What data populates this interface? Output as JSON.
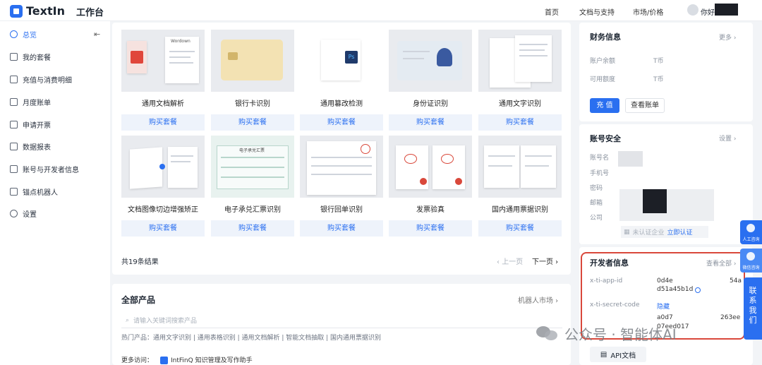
{
  "topbar": {
    "logo_text": "TextIn",
    "workbench": "工作台",
    "nav": [
      "首页",
      "文档与支持",
      "市场/价格"
    ],
    "greeting": "你好，"
  },
  "sidebar": {
    "items": [
      {
        "label": "总览",
        "icon": "dashboard-icon",
        "active": true
      },
      {
        "label": "我的套餐",
        "icon": "grid-icon"
      },
      {
        "label": "充值与消费明细",
        "icon": "wallet-icon"
      },
      {
        "label": "月度账单",
        "icon": "bill-icon"
      },
      {
        "label": "申请开票",
        "icon": "invoice-icon"
      },
      {
        "label": "数据报表",
        "icon": "chart-icon"
      },
      {
        "label": "账号与开发者信息",
        "icon": "user-icon"
      },
      {
        "label": "锚点机器人",
        "icon": "robot-icon"
      },
      {
        "label": "设置",
        "icon": "gear-icon"
      }
    ]
  },
  "products": {
    "buy_label": "购买套餐",
    "cards": [
      {
        "title": "通用文档解析",
        "thumb_label": "Wordown"
      },
      {
        "title": "银行卡识别"
      },
      {
        "title": "通用篡改检测",
        "thumb_label": "Ps"
      },
      {
        "title": "身份证识别"
      },
      {
        "title": "通用文字识别"
      },
      {
        "title": "文档图像切边增强矫正"
      },
      {
        "title": "电子承兑汇票识别",
        "thumb_label": "电子承兑汇票"
      },
      {
        "title": "银行回单识别"
      },
      {
        "title": "发票验真"
      },
      {
        "title": "国内通用票据识别"
      }
    ],
    "total": "共19条结果",
    "prev": "上一页",
    "next": "下一页"
  },
  "all_products": {
    "title": "全部产品",
    "robot_market": "机器人市场",
    "search_placeholder": "请输入关键词搜索产品",
    "hot": "热门产品：通用文字识别 | 通用表格识别 | 通用文档解析 | 智能文档抽取 | 国内通用票据识别",
    "more_prefix": "更多访问：",
    "more_link": "IntFinQ 知识管理及写作助手"
  },
  "finance": {
    "title": "财务信息",
    "more": "更多",
    "balance_label": "账户余额",
    "balance_unit": "T币",
    "quota_label": "可用额度",
    "quota_unit": "T币",
    "recharge": "充 值",
    "view_bill": "查看账单"
  },
  "security": {
    "title": "账号安全",
    "settings": "设置",
    "fields": [
      "账号名",
      "手机号",
      "密码",
      "邮箱",
      "公司"
    ],
    "verify_status": "未认证企业",
    "verify_link": "立即认证"
  },
  "developer": {
    "title": "开发者信息",
    "view_all": "查看全部",
    "app_id_label": "x-ti-app-id",
    "app_id_part1": "0d4e",
    "app_id_part2": "d51a45b1d",
    "app_id_tail": "54a",
    "secret_label": "x-ti-secret-code",
    "hide_label": "隐藏",
    "secret_part1": "a0d7",
    "secret_tail": "263ee",
    "secret_part2": "07eed017",
    "api_docs": "API文档"
  },
  "contact": {
    "human_service": "人工咨询",
    "wechat": "微信咨询",
    "contact_us": "联系我们"
  },
  "watermark": "公众号 · 智能体AI",
  "colors": {
    "accent": "#2a6ff0",
    "highlight_border": "#d9483b"
  }
}
